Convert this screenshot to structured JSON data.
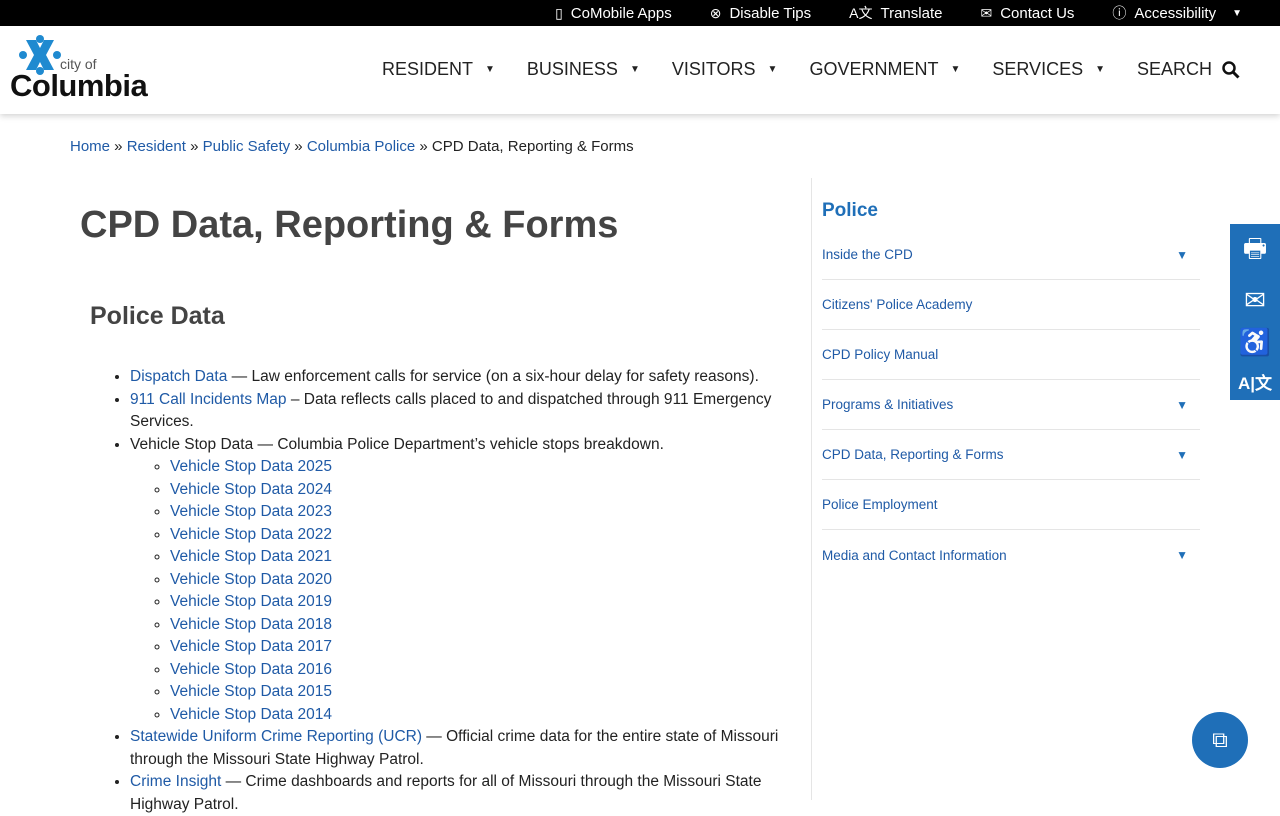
{
  "topbar": [
    {
      "icon": "phone-icon",
      "label": "CoMobile Apps"
    },
    {
      "icon": "close-circle-icon",
      "label": "Disable Tips"
    },
    {
      "icon": "translate-icon",
      "label": "Translate"
    },
    {
      "icon": "envelope-icon",
      "label": "Contact Us"
    },
    {
      "icon": "accessibility-icon",
      "label": "Accessibility"
    }
  ],
  "logo": {
    "city_of": "city of",
    "name": "Columbia"
  },
  "nav": [
    "RESIDENT",
    "BUSINESS",
    "VISITORS",
    "GOVERNMENT",
    "SERVICES"
  ],
  "search_label": "SEARCH",
  "breadcrumb": [
    "Home",
    "Resident",
    "Public Safety",
    "Columbia Police"
  ],
  "breadcrumb_current": "CPD Data, Reporting & Forms",
  "title": "CPD Data, Reporting & Forms",
  "section": "Police Data",
  "items": {
    "dispatch": {
      "link": "Dispatch Data",
      "text": " — Law enforcement calls for service (on a six-hour delay for safety reasons)."
    },
    "map": {
      "link": "911 Call Incidents Map",
      "text": " – Data reflects calls placed to and dispatched through 911 Emergency Services."
    },
    "vehicle": {
      "text": "Vehicle Stop Data — Columbia Police Department’s vehicle stops breakdown.",
      "links": [
        "Vehicle Stop Data 2025",
        "Vehicle Stop Data 2024",
        "Vehicle Stop Data 2023",
        "Vehicle Stop Data 2022",
        "Vehicle Stop Data 2021",
        "Vehicle Stop Data 2020",
        "Vehicle Stop Data 2019",
        "Vehicle Stop Data 2018",
        "Vehicle Stop Data 2017",
        "Vehicle Stop Data 2016",
        "Vehicle Stop Data 2015",
        "Vehicle Stop Data 2014"
      ]
    },
    "ucr": {
      "link": "Statewide Uniform Crime Reporting (UCR)",
      "text": " — Official crime data for the entire state of Missouri through the Missouri State Highway Patrol."
    },
    "insight": {
      "link": "Crime Insight",
      "text": " — Crime dashboards and reports for all of Missouri through the Missouri State Highway Patrol."
    }
  },
  "sidebar": {
    "title": "Police",
    "items": [
      {
        "label": "Inside the CPD",
        "expand": true
      },
      {
        "label": "Citizens' Police Academy",
        "expand": false
      },
      {
        "label": "CPD Policy Manual",
        "expand": false
      },
      {
        "label": "Programs & Initiatives",
        "expand": true
      },
      {
        "label": "CPD Data, Reporting & Forms",
        "expand": true
      },
      {
        "label": "Police Employment",
        "expand": false
      },
      {
        "label": "Media and Contact Information",
        "expand": true
      }
    ]
  },
  "colors": {
    "accent": "#1f6fb8",
    "link": "#1f5aa6"
  }
}
